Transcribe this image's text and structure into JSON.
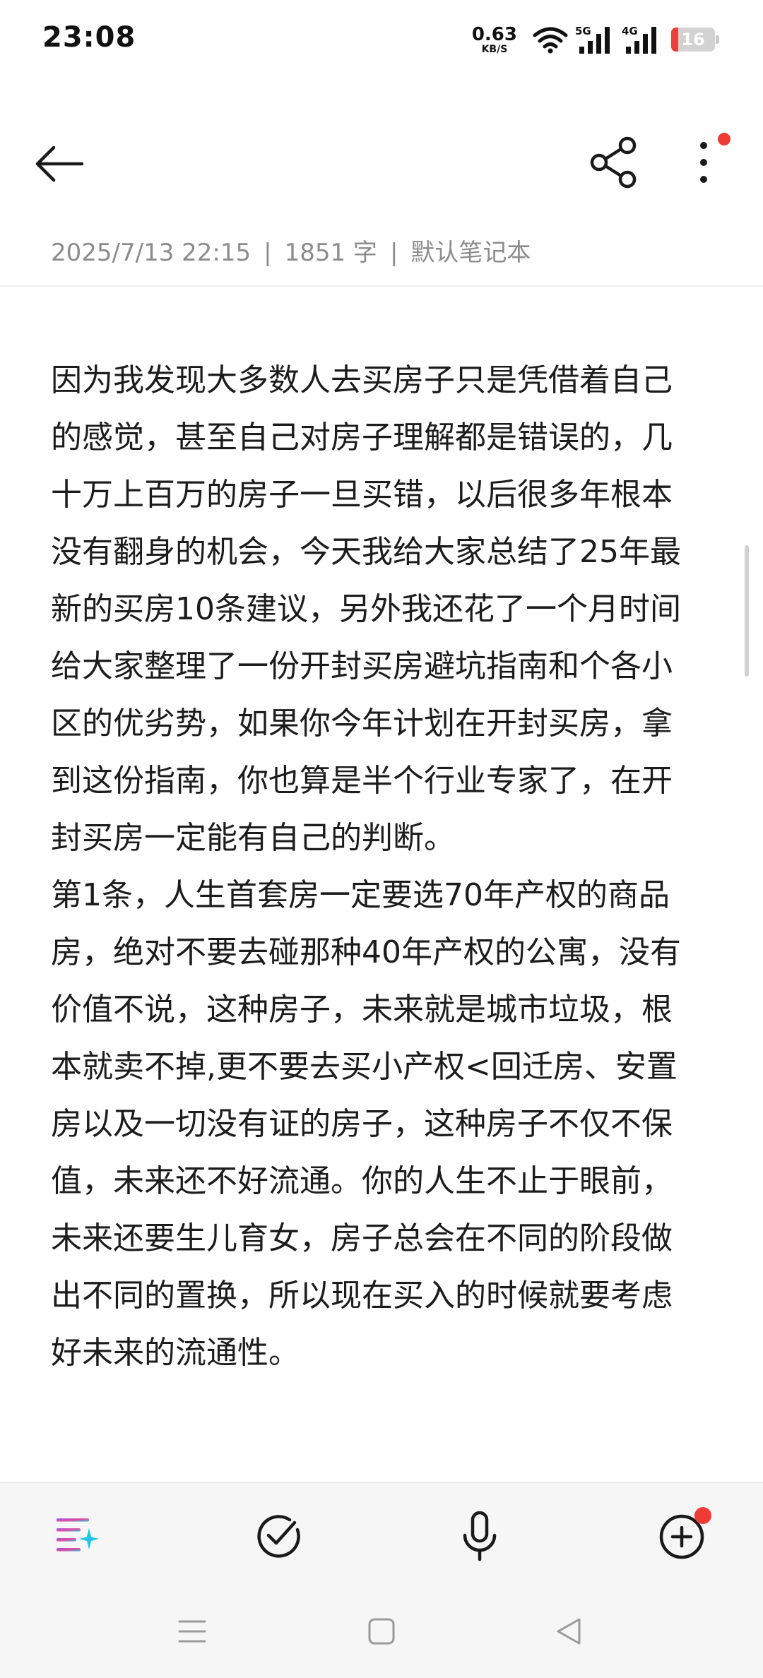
{
  "status_bar": {
    "time": "23:08",
    "net_speed_value": "0.63",
    "net_speed_unit": "KB/S",
    "signal1_label": "5G",
    "signal2_label": "4G",
    "battery_level": "16",
    "battery_fraction": 0.16,
    "battery_color": "#e8413b"
  },
  "app_bar": {
    "back_icon": "arrow-left-icon",
    "share_icon": "share-icon",
    "more_icon": "more-vertical-icon",
    "notification_dot_color": "#ee3b33"
  },
  "meta": {
    "datetime": "2025/7/13 22:15",
    "separator": "|",
    "word_count": "1851 字",
    "notebook": "默认笔记本"
  },
  "note": {
    "paragraphs": [
      "因为我发现大多数人去买房子只是凭借着自己的感觉，甚至自己对房子理解都是错误的，几十万上百万的房子一旦买错，以后很多年根本没有翻身的机会，今天我给大家总结了25年最新的买房10条建议，另外我还花了一个月时间给大家整理了一份开封买房避坑指南和个各小区的优劣势，如果你今年计划在开封买房，拿到这份指南，你也算是半个行业专家了，在开封买房一定能有自己的判断。",
      "第1条，人生首套房一定要选70年产权的商品房，绝对不要去碰那种40年产权的公寓，没有价值不说，这种房子，未来就是城市垃圾，根本就卖不掉,更不要去买小产权<回迁房、安置房以及一切没有证的房子，这种房子不仅不保值，未来还不好流通。你的人生不止于眼前，未来还要生儿育女，房子总会在不同的阶段做出不同的置换，所以现在买入的时候就要考虑好未来的流通性。"
    ]
  },
  "toolbar": {
    "ai_icon": "ai-sparkle-icon",
    "todo_icon": "check-circle-icon",
    "voice_icon": "microphone-icon",
    "add_icon": "plus-circle-icon"
  },
  "nav_bar": {
    "menu_icon": "menu-icon",
    "home_icon": "home-square-icon",
    "back_icon": "back-triangle-icon"
  }
}
